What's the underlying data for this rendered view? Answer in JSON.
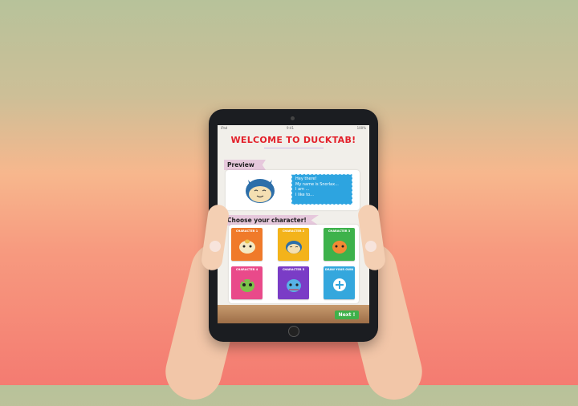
{
  "app": {
    "title": "WELCOME TO DUCKTAB!"
  },
  "statusbar": {
    "left": "iPad",
    "time": "9:41",
    "right": "100%"
  },
  "preview": {
    "heading": "Preview",
    "speech_lines": [
      "Hey there!",
      "My name is Snorlax...",
      "I am ...",
      "I like to..."
    ]
  },
  "choose": {
    "heading": "Choose your character!",
    "cards": [
      {
        "label": "CHARACTER 1",
        "color": "#f07a2a"
      },
      {
        "label": "CHARACTER 2",
        "color": "#f3b31b"
      },
      {
        "label": "CHARACTER 3",
        "color": "#3db24b"
      },
      {
        "label": "CHARACTER 4",
        "color": "#e94a8a"
      },
      {
        "label": "CHARACTER 5",
        "color": "#7a3cc6"
      },
      {
        "label": "DRAW YOUR OWN",
        "color": "#34a7dd"
      }
    ]
  },
  "next_button": "Next !"
}
